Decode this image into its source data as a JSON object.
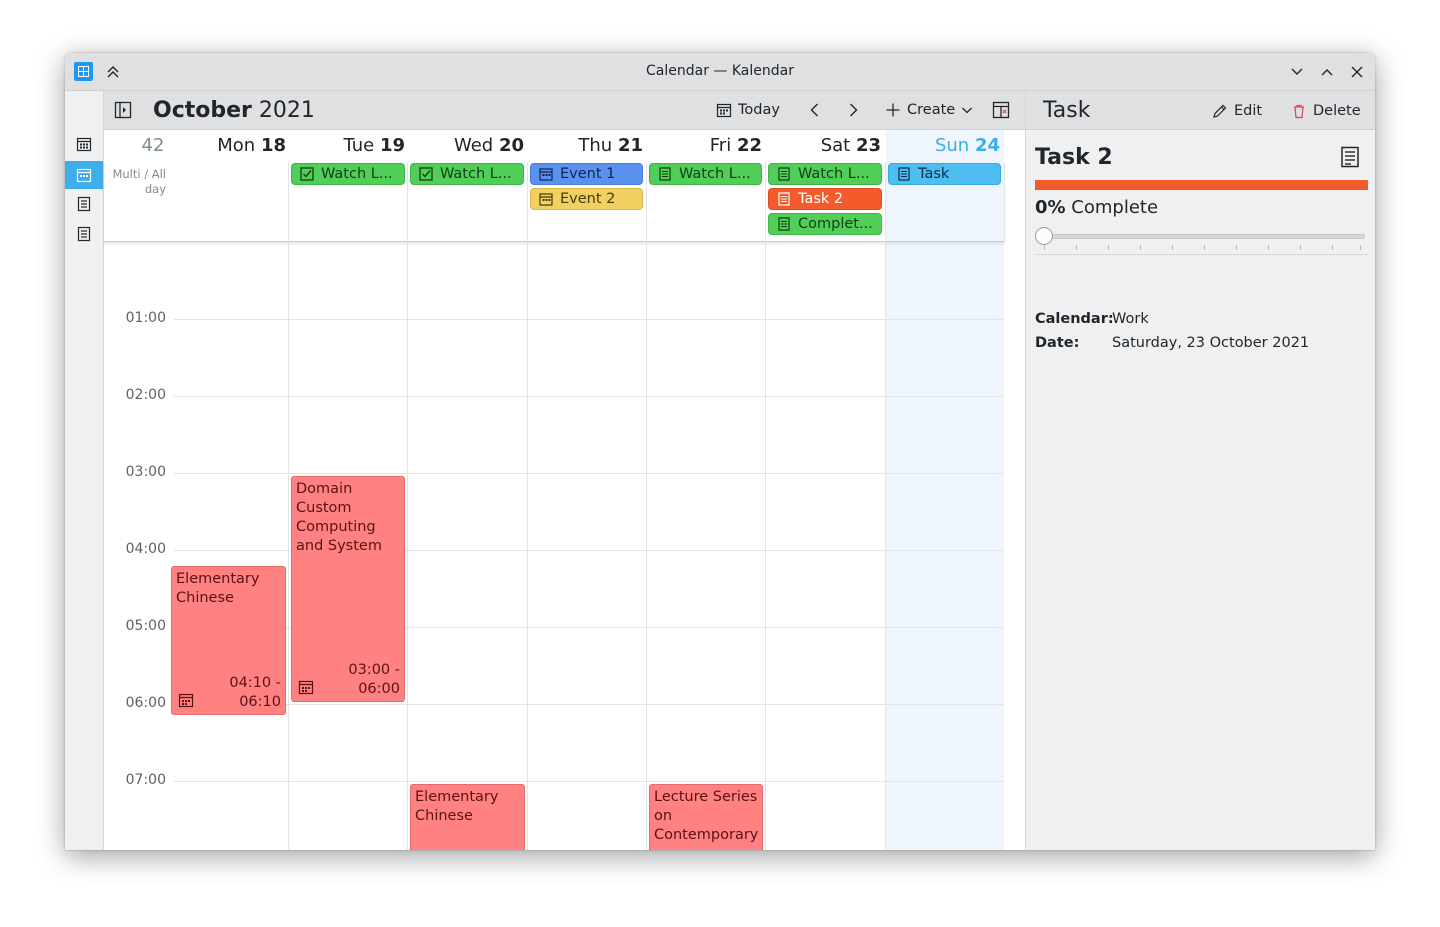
{
  "window": {
    "title": "Calendar — Kalendar"
  },
  "toolbar": {
    "month": "October",
    "year": "2021",
    "today_label": "Today",
    "create_label": "Create"
  },
  "week": {
    "week_number": "42",
    "allday_label": "Multi / All day",
    "days": [
      {
        "name": "Mon",
        "num": "18"
      },
      {
        "name": "Tue",
        "num": "19"
      },
      {
        "name": "Wed",
        "num": "20"
      },
      {
        "name": "Thu",
        "num": "21"
      },
      {
        "name": "Fri",
        "num": "22"
      },
      {
        "name": "Sat",
        "num": "23"
      },
      {
        "name": "Sun",
        "num": "24"
      }
    ],
    "hours": [
      "01:00",
      "02:00",
      "03:00",
      "04:00",
      "05:00",
      "06:00",
      "07:00"
    ]
  },
  "allday_items": {
    "tue_watch": "Watch L...",
    "wed_watch": "Watch L...",
    "thu_event1": "Event 1",
    "thu_event2": "Event 2",
    "fri_watch": "Watch L...",
    "sat_watch": "Watch L...",
    "sat_task2": "Task 2",
    "sat_complete": "Complet...",
    "sun_task": "Task"
  },
  "events": {
    "mon_elementary": {
      "title": "Elementary Chinese",
      "start": "04:10 -",
      "end": "06:10"
    },
    "tue_domain": {
      "title": "Domain Custom Computing and System",
      "start": "03:00 -",
      "end": "06:00"
    },
    "wed_elementary": {
      "title": "Elementary Chinese"
    },
    "fri_lecture": {
      "title": "Lecture Series on Contemporary"
    }
  },
  "panel": {
    "title": "Task",
    "edit_label": "Edit",
    "delete_label": "Delete",
    "task_name": "Task 2",
    "percent": "0%",
    "complete_label": "Complete",
    "progress_value": 0,
    "calendar_key": "Calendar:",
    "calendar_value": "Work",
    "date_key": "Date:",
    "date_value": "Saturday, 23 October 2021"
  },
  "colors": {
    "accent": "#3daee9",
    "event_red": "#ff8181",
    "task_green": "#50ce58",
    "event_blue": "#5b92f0",
    "event_yellow": "#f0d060",
    "task_orange": "#f45b2c",
    "task_sky": "#4dbdf2"
  }
}
